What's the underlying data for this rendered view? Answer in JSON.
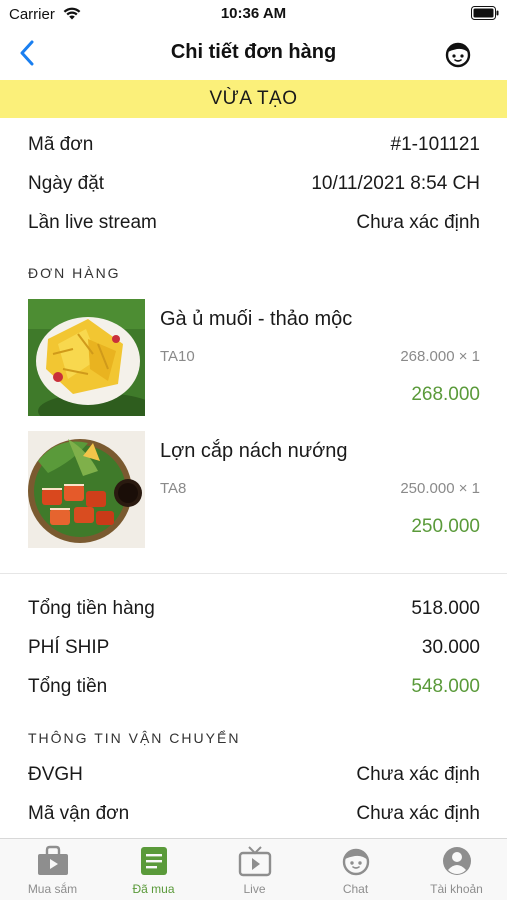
{
  "status_bar": {
    "carrier": "Carrier",
    "time": "10:36 AM"
  },
  "nav": {
    "title": "Chi tiết đơn hàng"
  },
  "order_status": "VỪA TẠO",
  "order_info": [
    {
      "label": "Mã đơn",
      "value": "#1-101121"
    },
    {
      "label": "Ngày đặt",
      "value": "10/11/2021 8:54 CH"
    },
    {
      "label": "Lần live stream",
      "value": "Chưa xác định"
    }
  ],
  "items_section_title": "ĐƠN HÀNG",
  "items": [
    {
      "name": "Gà ủ muối - thảo mộc",
      "code": "TA10",
      "unit": "268.000 × 1",
      "total": "268.000",
      "image": "yellow-salted-chicken-dish"
    },
    {
      "name": "Lợn cắp nách nướng",
      "code": "TA8",
      "unit": "250.000 × 1",
      "total": "250.000",
      "image": "grilled-pork-platter"
    }
  ],
  "summary": [
    {
      "label": "Tổng tiền hàng",
      "value": "518.000"
    },
    {
      "label": "PHÍ SHIP",
      "value": "30.000"
    },
    {
      "label": "Tổng tiền",
      "value": "548.000"
    }
  ],
  "shipping_section_title": "THÔNG TIN VẬN CHUYỂN",
  "shipping": [
    {
      "label": "ĐVGH",
      "value": "Chưa xác định"
    },
    {
      "label": "Mã vận đơn",
      "value": "Chưa xác định"
    }
  ],
  "tabs": [
    {
      "label": "Mua sắm",
      "icon": "shopping-bag-icon"
    },
    {
      "label": "Đã mua",
      "icon": "order-list-icon",
      "active": true
    },
    {
      "label": "Live",
      "icon": "tv-live-icon"
    },
    {
      "label": "Chat",
      "icon": "chat-face-icon"
    },
    {
      "label": "Tài khoản",
      "icon": "account-icon"
    }
  ],
  "colors": {
    "accent_green": "#5a9a3a",
    "banner_yellow": "#fbf07a",
    "link_blue": "#1a7ff0"
  }
}
